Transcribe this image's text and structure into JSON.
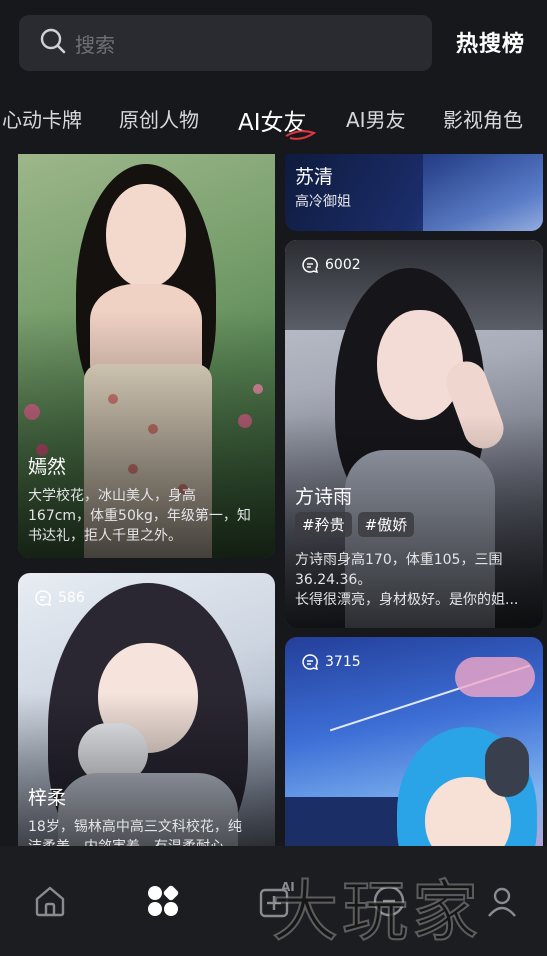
{
  "search": {
    "placeholder": "搜索",
    "icon": "search-icon"
  },
  "hot_search_label": "热搜榜",
  "tabs": [
    {
      "label": "心动卡牌"
    },
    {
      "label": "原创人物"
    },
    {
      "label": "AI女友",
      "active": true
    },
    {
      "label": "AI男友"
    },
    {
      "label": "影视角色"
    }
  ],
  "cards": {
    "yanran": {
      "name": "嫣然",
      "desc": [
        "大学校花，冰山美人，身高",
        "167cm，体重50kg，年级第一，知",
        "书达礼，拒人千里之外。"
      ]
    },
    "suqing": {
      "name": "苏清",
      "desc": "高冷御姐"
    },
    "fangshiyu": {
      "count": "6002",
      "name": "方诗雨",
      "tags": [
        "#矜贵",
        "#傲娇"
      ],
      "desc": [
        "方诗雨身高170，体重105，三围",
        "36.24.36。",
        "长得很漂亮，身材极好。是你的姐..."
      ]
    },
    "zirou": {
      "count": "586",
      "name": "梓柔",
      "desc": [
        "18岁，锡林高中高三文科校花，纯",
        "洁柔美，内敛害羞，有温柔耐心..."
      ]
    },
    "anime": {
      "count": "3715"
    }
  },
  "nav": {
    "items": [
      "home-icon",
      "discover-icon",
      "create-ai-icon",
      "message-icon",
      "profile-icon"
    ],
    "create_badge": "AI"
  },
  "watermark": "大玩家",
  "colors": {
    "background": "#17181c",
    "search_bg": "#2a2b31",
    "tab_accent": "#e0353f",
    "nav_bg": "#1c1d21"
  }
}
